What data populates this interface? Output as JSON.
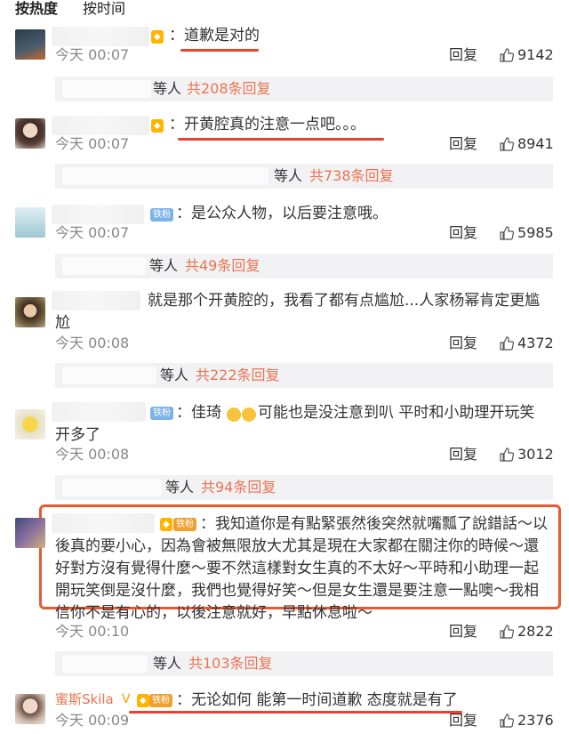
{
  "tabs": {
    "hot": "按热度",
    "time": "按时间"
  },
  "reply_label": "回复",
  "who_suffix": "等人",
  "comments": [
    {
      "text": "：道歉是对的",
      "time": "今天 00:07",
      "likes": "9142",
      "replies": "共208条回复"
    },
    {
      "text": "：开黄腔真的注意一点吧。。。",
      "time": "今天 00:07",
      "likes": "8941",
      "replies": "共738条回复"
    },
    {
      "badge": "铁粉",
      "text": "：是公众人物，以后要注意哦。",
      "time": "今天 00:07",
      "likes": "5985",
      "replies": "共49条回复"
    },
    {
      "line1": "就是那个开黄腔的，我看了都有点尴尬...人家杨幂肯定更尴",
      "line2": "尬",
      "time": "今天 00:08",
      "likes": "4372",
      "replies": "共222条回复"
    },
    {
      "badge": "铁粉",
      "line1a": "：佳琦",
      "line1b": "可能也是没注意到叭 平时和小助理开玩笑",
      "line2": "开多了",
      "time": "今天 00:08",
      "likes": "3012",
      "replies": "共94条回复"
    },
    {
      "badge": "铁粉",
      "lines": [
        "：我知道你是有點緊張然後突然就嘴瓢了說錯話～以",
        "後真的要小心，因為會被無限放大尤其是現在大家都在關注你的時候～還",
        "好對方沒有覺得什麼～要不然這樣對女生真的不太好～平時和小助理一起",
        "開玩笑倒是沒什麼，我們也覺得好笑～但是女生還是要注意一點噢～我相",
        "信你不是有心的，以後注意就好，早點休息啦～"
      ],
      "time": "今天 00:10",
      "likes": "2822",
      "replies": "共103条回复"
    },
    {
      "name": "蜜斯Skila",
      "badge": "铁粉",
      "text": "：无论如何 能第一时间道歉 态度就是有了",
      "time": "今天 00:09",
      "likes": "2376"
    }
  ],
  "colors": {
    "accent": "#eb7350",
    "underline": "#e6452d",
    "highlight_box": "#e85a30",
    "reply_bar": "#f2f2f5"
  }
}
